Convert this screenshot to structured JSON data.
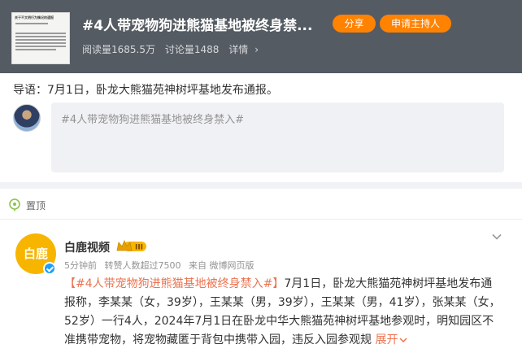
{
  "topic": {
    "title": "#4人带宠物狗进熊猫基地被终身禁...",
    "thumbnail_heading": "关于不文明行为情况的通报",
    "share_label": "分享",
    "host_label": "申请主持人",
    "reads": "阅读量1685.5万",
    "discussions": "讨论量1488",
    "details": "详情",
    "details_icon": "chevron-right-icon"
  },
  "lead": {
    "text": "导语：7月1日，卧龙大熊猫苑神树坪基地发布通报。"
  },
  "composer": {
    "placeholder": "#4人带宠物狗进熊猫基地被终身禁入#"
  },
  "pinned": {
    "label": "置顶"
  },
  "post": {
    "author": "白鹿视频",
    "avatar_text": "白鹿",
    "level": "III",
    "time": "5分钟前",
    "reposts": "转赞人数超过7500",
    "source": "来自 微博网页版",
    "tag": "【#4人带宠物狗进熊猫基地被终身禁入#】",
    "body": "7月1日，卧龙大熊猫苑神树坪基地发布通报称，李某某（女，39岁），王某某（男，39岁），王某某（男，41岁），张某某（女，52岁）一行4人，2024年7月1日在卧龙中华大熊猫苑神树坪基地参观时，明知园区不准携带宠物，将宠物藏匿于背包中携带入园，违反入园参观规",
    "expand": "展开"
  },
  "colors": {
    "header_bg": "#555b63",
    "accent_orange": "#ff8200",
    "link_orange": "#eb7350",
    "verified_blue": "#1d9ef7",
    "avatar_gold": "#f7b500"
  }
}
